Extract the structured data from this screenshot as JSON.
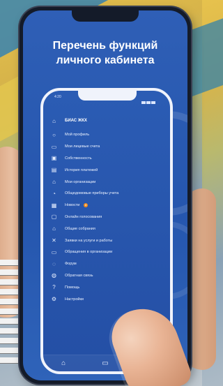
{
  "screen": {
    "title_line1": "Перечень функций",
    "title_line2": "личного кабинета"
  },
  "status_bar": {
    "time": "4:20"
  },
  "app": {
    "name": "БИАС ЖКХ",
    "menu": [
      {
        "label": "Мой профиль",
        "icon": "user-icon"
      },
      {
        "label": "Мои лицевые счета",
        "icon": "accounts-icon"
      },
      {
        "label": "Собственность",
        "icon": "property-icon"
      },
      {
        "label": "История платежей",
        "icon": "payment-history-icon"
      },
      {
        "label": "Мои организации",
        "icon": "organizations-icon"
      },
      {
        "label": "Общедомовые приборы учета",
        "icon": "meter-icon"
      },
      {
        "label": "Новости",
        "icon": "news-icon",
        "badge": "8"
      },
      {
        "label": "Онлайн голосования",
        "icon": "voting-icon"
      },
      {
        "label": "Общие собрания",
        "icon": "meetings-icon"
      },
      {
        "label": "Заявки на услуги и работы",
        "icon": "requests-icon"
      },
      {
        "label": "Обращения в организации",
        "icon": "appeals-icon"
      },
      {
        "label": "Форум",
        "icon": "forum-icon"
      },
      {
        "label": "Обратная связь",
        "icon": "feedback-icon"
      },
      {
        "label": "Помощь",
        "icon": "help-icon"
      },
      {
        "label": "Настройки",
        "icon": "settings-icon"
      }
    ]
  },
  "tabbar": {
    "home": "⌂",
    "card": "▭",
    "info": "ⓘ"
  }
}
